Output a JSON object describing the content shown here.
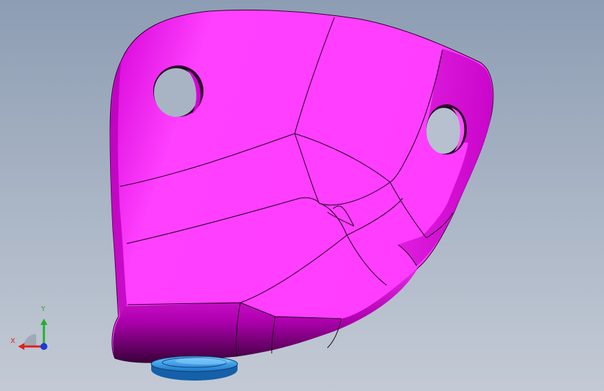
{
  "viewport": {
    "background_top": "#8d9db3",
    "background_bottom": "#c3cad5"
  },
  "model": {
    "part_color": "#ff3cff",
    "part_shade_color": "#c800c8",
    "edge_color": "#1a001a",
    "boss_color": "#2fa3f0"
  },
  "triad": {
    "x_label": "X",
    "y_label": "Y",
    "x_color": "#e0201e",
    "y_color": "#22b02a",
    "z_color": "#1c3ad8"
  }
}
